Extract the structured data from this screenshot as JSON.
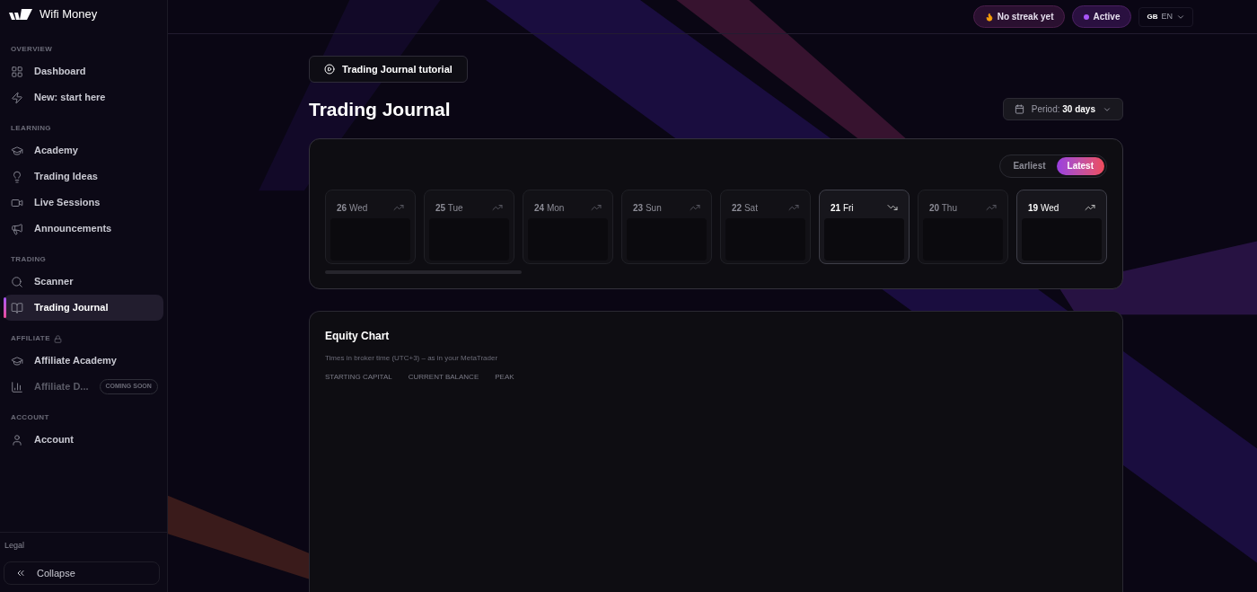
{
  "brand": {
    "name": "Wifi Money"
  },
  "sidebar": {
    "sections": [
      {
        "title": "OVERVIEW",
        "items": [
          {
            "label": "Dashboard",
            "selected": false,
            "disabled": false
          },
          {
            "label": "New: start here",
            "selected": false,
            "disabled": false
          }
        ]
      },
      {
        "title": "LEARNING",
        "items": [
          {
            "label": "Academy",
            "selected": false,
            "disabled": false
          },
          {
            "label": "Trading Ideas",
            "selected": false,
            "disabled": false
          },
          {
            "label": "Live Sessions",
            "selected": false,
            "disabled": false
          },
          {
            "label": "Announcements",
            "selected": false,
            "disabled": false
          }
        ]
      },
      {
        "title": "TRADING",
        "items": [
          {
            "label": "Scanner",
            "selected": false,
            "disabled": false
          },
          {
            "label": "Trading Journal",
            "selected": true,
            "disabled": false
          }
        ]
      },
      {
        "title": "AFFILIATE",
        "locked": true,
        "items": [
          {
            "label": "Affiliate Academy",
            "selected": false,
            "disabled": false
          },
          {
            "label": "Affiliate D...",
            "selected": false,
            "disabled": true,
            "badge": "COMING SOON"
          }
        ]
      },
      {
        "title": "ACCOUNT",
        "items": [
          {
            "label": "Account",
            "selected": false,
            "disabled": false
          }
        ]
      }
    ],
    "legal": "Legal",
    "collapse": "Collapse"
  },
  "topbar": {
    "streak": "No streak yet",
    "status": "Active",
    "flag": "GB",
    "language": "EN"
  },
  "tutorial_button": "Trading Journal tutorial",
  "title": "Trading Journal",
  "period": {
    "label": "Period:",
    "value": "30 days"
  },
  "order_toggle": [
    {
      "label": "Earliest",
      "selected": false
    },
    {
      "label": "Latest",
      "selected": true
    }
  ],
  "days": [
    {
      "date": "26",
      "weekday": "Wed",
      "active": false,
      "kind": "rising"
    },
    {
      "date": "25",
      "weekday": "Tue",
      "active": false,
      "kind": "rising"
    },
    {
      "date": "24",
      "weekday": "Mon",
      "active": false,
      "kind": "rising"
    },
    {
      "date": "23",
      "weekday": "Sun",
      "active": false,
      "kind": "rising"
    },
    {
      "date": "22",
      "weekday": "Sat",
      "active": false,
      "kind": "rising"
    },
    {
      "date": "21",
      "weekday": "Fri",
      "active": true,
      "kind": "falling"
    },
    {
      "date": "20",
      "weekday": "Thu",
      "active": false,
      "kind": "rising"
    },
    {
      "date": "19",
      "weekday": "Wed",
      "active": true,
      "kind": "rising"
    }
  ],
  "equity": {
    "title": "Equity Chart",
    "note": "Times in broker time (UTC+3) – as in your MetaTrader",
    "stats": [
      "STARTING CAPITAL",
      "CURRENT BALANCE",
      "PEAK"
    ]
  }
}
